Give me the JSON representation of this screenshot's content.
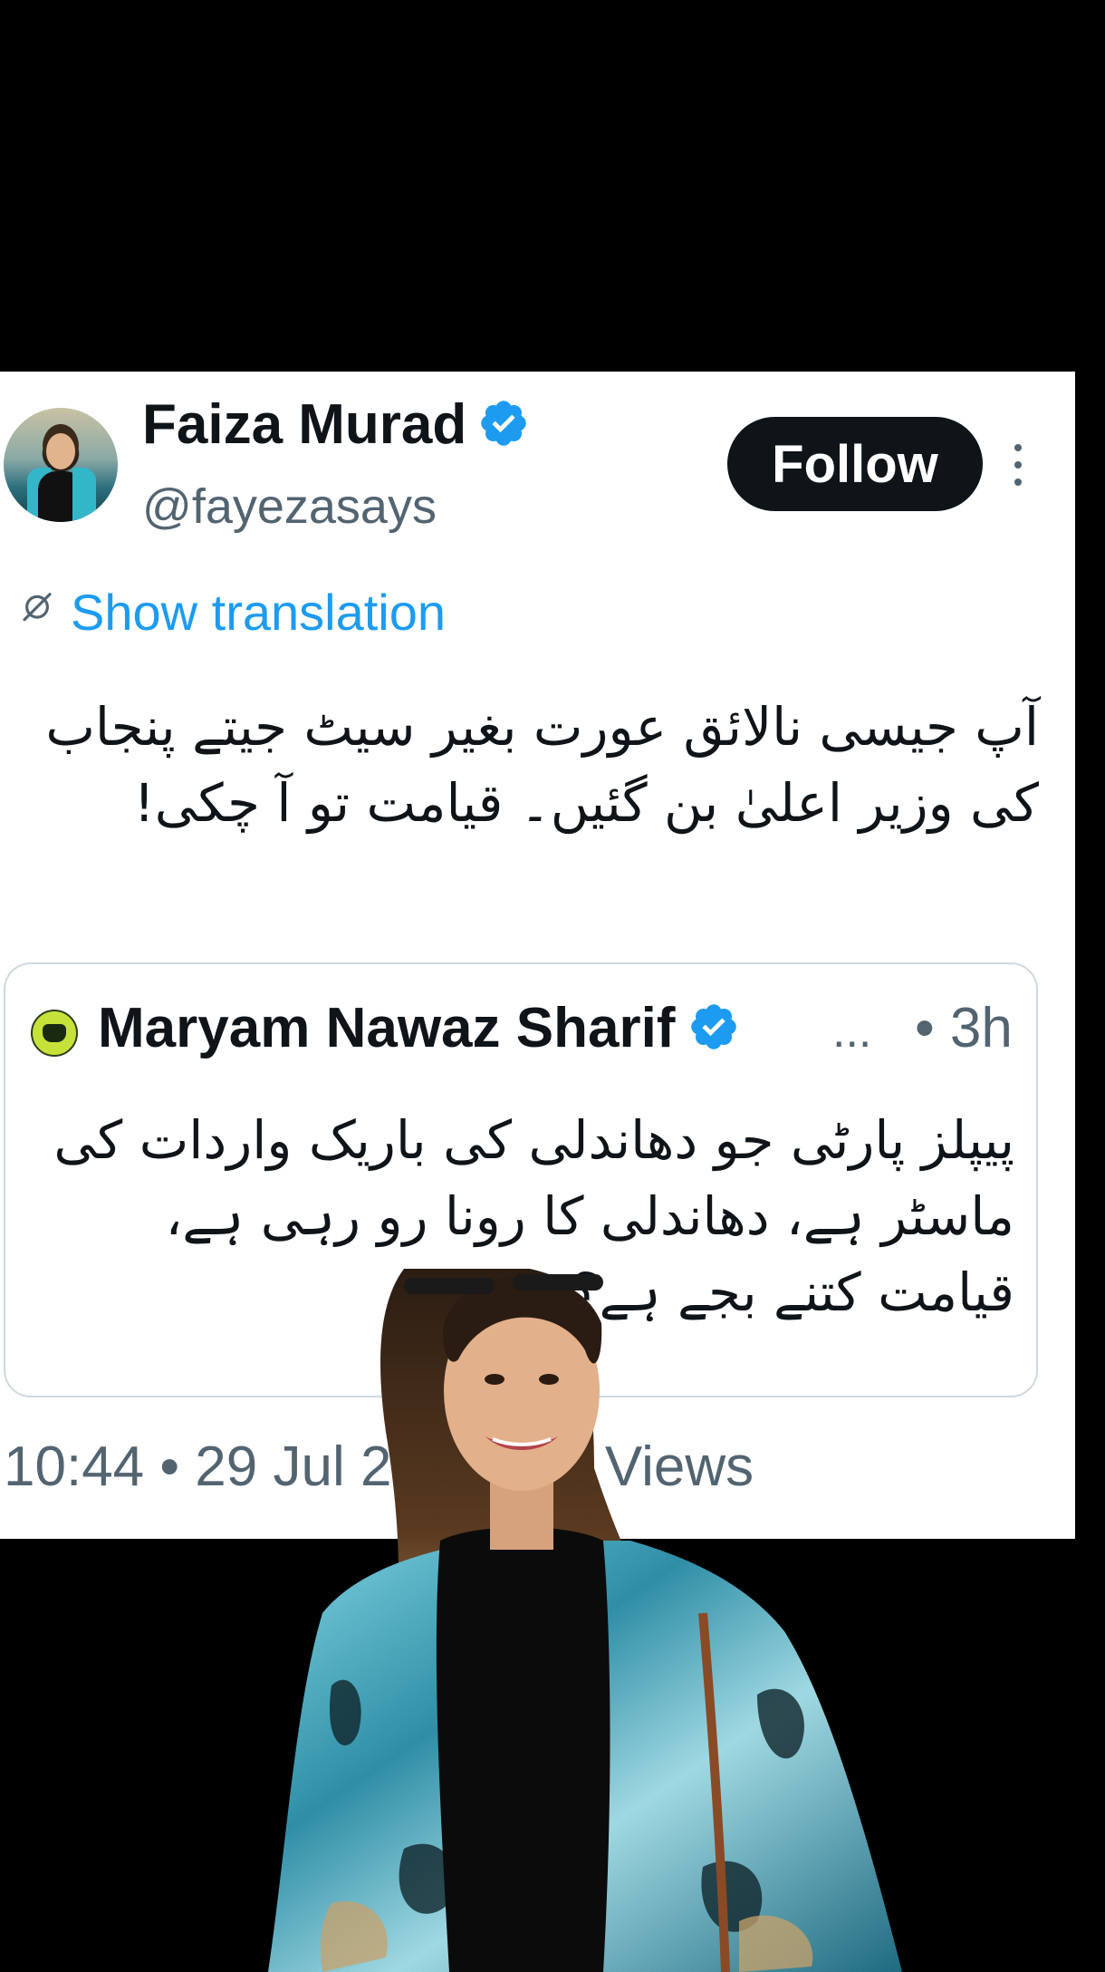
{
  "tweet": {
    "author": {
      "display_name": "Faiza Murad",
      "handle": "@fayezasays",
      "verified": true,
      "avatar_icon": "profile-photo-avatar"
    },
    "follow_label": "Follow",
    "more_icon": "vertical-ellipsis-icon",
    "translate_icon": "translate-icon",
    "show_translation_label": "Show translation",
    "text": "آپ جیسی نالائق عورت بغیر سیٹ جیتے پنجاب کی وزیر اعلیٰ بن گئیں۔ قیامت تو آ چکی!",
    "meta": "10:44 • 29 Jul 26 • 1.8K Views",
    "colors": {
      "link": "#1d9bf0",
      "verified": "#1d9bf0",
      "secondary_text": "#536471",
      "primary_text": "#0f1419",
      "follow_bg": "#0f1419"
    }
  },
  "quoted_tweet": {
    "author": {
      "display_name": "Maryam Nawaz Sharif",
      "verified": true,
      "avatar_icon": "party-logo-avatar"
    },
    "ellipsis": "...",
    "time": "• 3h",
    "text": "پیپلز پارٹی جو دھاندلی کی باریک واردات کی ماسٹر ہے، دھاندلی کا رونا رو رہی ہے، قیامت کتنے بجے ہے؟"
  },
  "overlay": {
    "description_icon": "woman-cutout-photo"
  }
}
